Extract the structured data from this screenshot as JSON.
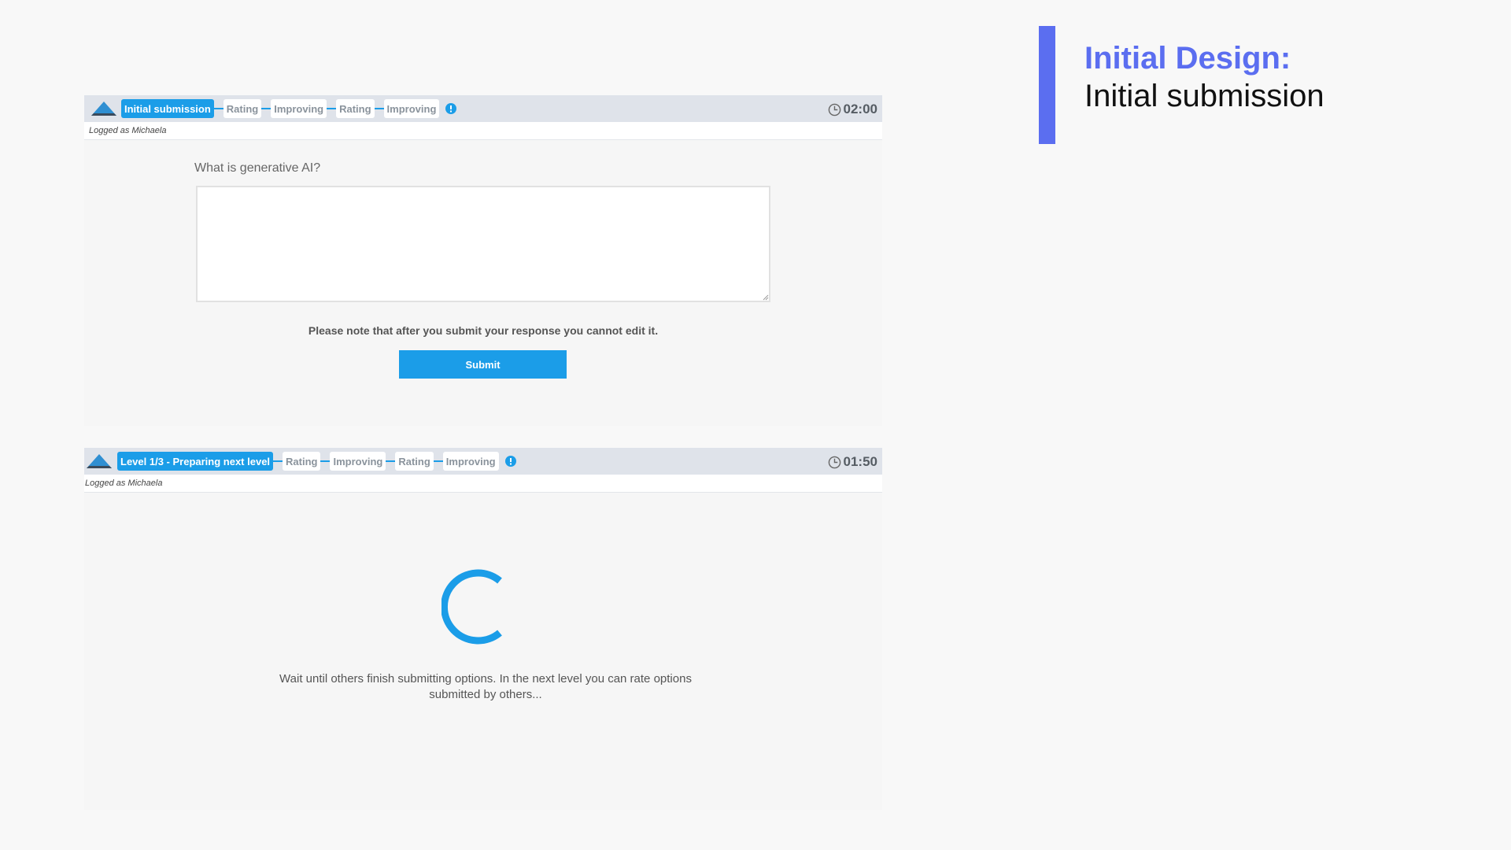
{
  "slide": {
    "title_line1": "Initial Design:",
    "title_line2": "Initial submission",
    "accent_color": "#5b6ef0"
  },
  "screen1": {
    "steps": [
      {
        "label": "Initial submission",
        "active": true
      },
      {
        "label": "Rating",
        "active": false
      },
      {
        "label": "Improving",
        "active": false
      },
      {
        "label": "Rating",
        "active": false
      },
      {
        "label": "Improving",
        "active": false
      }
    ],
    "timer": "02:00",
    "logged_as": "Logged as Michaela",
    "question": "What is generative AI?",
    "answer_value": "",
    "note": "Please note that after you submit your response you cannot edit it.",
    "submit_label": "Submit"
  },
  "screen2": {
    "steps": [
      {
        "label": "Level 1/3 - Preparing next level",
        "active": true
      },
      {
        "label": "Rating",
        "active": false
      },
      {
        "label": "Improving",
        "active": false
      },
      {
        "label": "Rating",
        "active": false
      },
      {
        "label": "Improving",
        "active": false
      }
    ],
    "timer": "01:50",
    "logged_as": "Logged as Michaela",
    "wait_message": "Wait until others finish submitting options. In the next level you can rate options submitted by others..."
  },
  "icons": {
    "logo": "triangle-logo-icon",
    "info": "info-icon",
    "clock": "clock-icon",
    "spinner": "loading-spinner-icon"
  },
  "colors": {
    "primary": "#1b9de8",
    "progress_bg": "#dfe3ea",
    "step_text": "#8a939c"
  }
}
